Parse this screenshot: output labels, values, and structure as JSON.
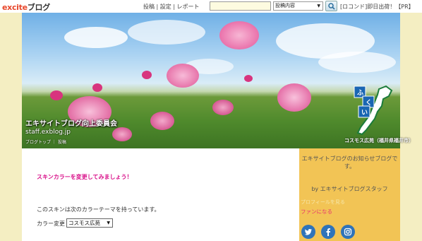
{
  "topbar": {
    "logo_excite": "excite",
    "logo_blog": "ブログ",
    "links": "投稿 | 設定 | レポート",
    "search_placeholder": "",
    "search_scope": "投稿内容",
    "right_links": "[ロコンド]即日出荷！【PR】"
  },
  "header": {
    "title": "エキサイトブログ向上委員会",
    "url": "staff.exblog.jp",
    "nav": "ブログトップ ｜ 投稿",
    "badge_caption": "コスモス広苑（福井県福井市）",
    "badge_chars": [
      "ふ",
      "く",
      "い"
    ]
  },
  "main": {
    "heading": "スキンカラーを変更してみましょう！",
    "text1": "このスキンは次のカラーテーマを持っています。",
    "color_label": "カラー変更",
    "color_value": "コスモス広苑"
  },
  "sidebar": {
    "notice": "エキサイトブログのお知らせブログです。",
    "byline": "by エキサイトブログスタッフ",
    "link_prof": "プロフィールを見る",
    "link_fan": "ファンになる"
  },
  "colors": {
    "frame": "#f4eec2",
    "sidebar": "#f2c455",
    "heading": "#d9118a",
    "fan_link": "#e8316e",
    "social": "#2f73b9"
  }
}
